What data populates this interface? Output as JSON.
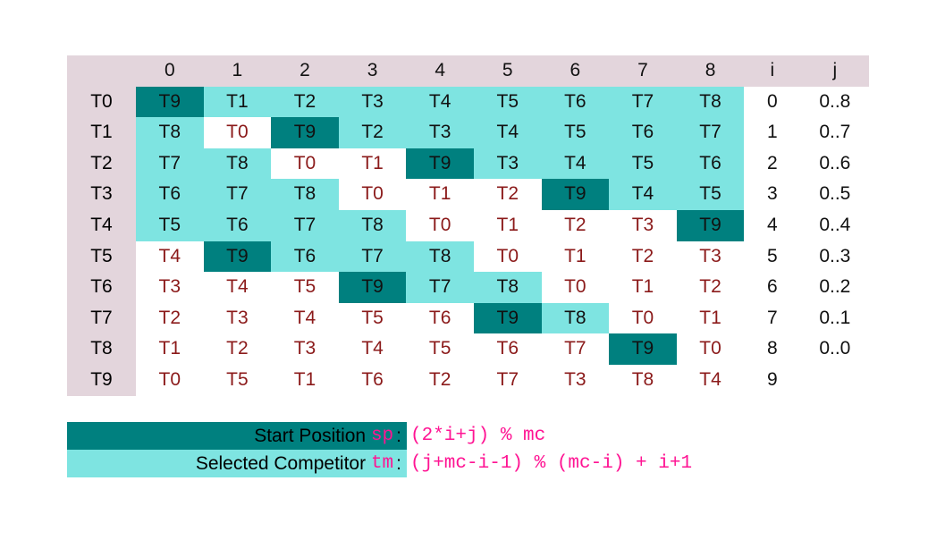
{
  "colors": {
    "start_position": "#00807f",
    "selected_competitor": "#7ee4e1",
    "header_band": "#e3d5dc",
    "cell_text": "#8b1a1a",
    "formula_text": "#ff1493",
    "page_background": "#ffffff"
  },
  "table": {
    "corner_label": "",
    "column_headers": [
      "0",
      "1",
      "2",
      "3",
      "4",
      "5",
      "6",
      "7",
      "8"
    ],
    "side_headers": [
      "i",
      "j"
    ],
    "row_labels": [
      "T0",
      "T1",
      "T2",
      "T3",
      "T4",
      "T5",
      "T6",
      "T7",
      "T8",
      "T9"
    ],
    "i_values": [
      "0",
      "1",
      "2",
      "3",
      "4",
      "5",
      "6",
      "7",
      "8",
      "9"
    ],
    "j_values": [
      "0..8",
      "0..7",
      "0..6",
      "0..5",
      "0..4",
      "0..3",
      "0..2",
      "0..1",
      "0..0",
      ""
    ],
    "rows": [
      {
        "label": "T0",
        "cells": [
          {
            "text": "T9",
            "state": "sp"
          },
          {
            "text": "T1",
            "state": "tm"
          },
          {
            "text": "T2",
            "state": "tm"
          },
          {
            "text": "T3",
            "state": "tm"
          },
          {
            "text": "T4",
            "state": "tm"
          },
          {
            "text": "T5",
            "state": "tm"
          },
          {
            "text": "T6",
            "state": "tm"
          },
          {
            "text": "T7",
            "state": "tm"
          },
          {
            "text": "T8",
            "state": "tm"
          }
        ],
        "i": "0",
        "j": "0..8"
      },
      {
        "label": "T1",
        "cells": [
          {
            "text": "T8",
            "state": "tm"
          },
          {
            "text": "T0",
            "state": "none"
          },
          {
            "text": "T9",
            "state": "sp"
          },
          {
            "text": "T2",
            "state": "tm"
          },
          {
            "text": "T3",
            "state": "tm"
          },
          {
            "text": "T4",
            "state": "tm"
          },
          {
            "text": "T5",
            "state": "tm"
          },
          {
            "text": "T6",
            "state": "tm"
          },
          {
            "text": "T7",
            "state": "tm"
          }
        ],
        "i": "1",
        "j": "0..7"
      },
      {
        "label": "T2",
        "cells": [
          {
            "text": "T7",
            "state": "tm"
          },
          {
            "text": "T8",
            "state": "tm"
          },
          {
            "text": "T0",
            "state": "none"
          },
          {
            "text": "T1",
            "state": "none"
          },
          {
            "text": "T9",
            "state": "sp"
          },
          {
            "text": "T3",
            "state": "tm"
          },
          {
            "text": "T4",
            "state": "tm"
          },
          {
            "text": "T5",
            "state": "tm"
          },
          {
            "text": "T6",
            "state": "tm"
          }
        ],
        "i": "2",
        "j": "0..6"
      },
      {
        "label": "T3",
        "cells": [
          {
            "text": "T6",
            "state": "tm"
          },
          {
            "text": "T7",
            "state": "tm"
          },
          {
            "text": "T8",
            "state": "tm"
          },
          {
            "text": "T0",
            "state": "none"
          },
          {
            "text": "T1",
            "state": "none"
          },
          {
            "text": "T2",
            "state": "none"
          },
          {
            "text": "T9",
            "state": "sp"
          },
          {
            "text": "T4",
            "state": "tm"
          },
          {
            "text": "T5",
            "state": "tm"
          }
        ],
        "i": "3",
        "j": "0..5"
      },
      {
        "label": "T4",
        "cells": [
          {
            "text": "T5",
            "state": "tm"
          },
          {
            "text": "T6",
            "state": "tm"
          },
          {
            "text": "T7",
            "state": "tm"
          },
          {
            "text": "T8",
            "state": "tm"
          },
          {
            "text": "T0",
            "state": "none"
          },
          {
            "text": "T1",
            "state": "none"
          },
          {
            "text": "T2",
            "state": "none"
          },
          {
            "text": "T3",
            "state": "none"
          },
          {
            "text": "T9",
            "state": "sp"
          }
        ],
        "i": "4",
        "j": "0..4"
      },
      {
        "label": "T5",
        "cells": [
          {
            "text": "T4",
            "state": "none"
          },
          {
            "text": "T9",
            "state": "sp"
          },
          {
            "text": "T6",
            "state": "tm"
          },
          {
            "text": "T7",
            "state": "tm"
          },
          {
            "text": "T8",
            "state": "tm"
          },
          {
            "text": "T0",
            "state": "none"
          },
          {
            "text": "T1",
            "state": "none"
          },
          {
            "text": "T2",
            "state": "none"
          },
          {
            "text": "T3",
            "state": "none"
          }
        ],
        "i": "5",
        "j": "0..3"
      },
      {
        "label": "T6",
        "cells": [
          {
            "text": "T3",
            "state": "none"
          },
          {
            "text": "T4",
            "state": "none"
          },
          {
            "text": "T5",
            "state": "none"
          },
          {
            "text": "T9",
            "state": "sp"
          },
          {
            "text": "T7",
            "state": "tm"
          },
          {
            "text": "T8",
            "state": "tm"
          },
          {
            "text": "T0",
            "state": "none"
          },
          {
            "text": "T1",
            "state": "none"
          },
          {
            "text": "T2",
            "state": "none"
          }
        ],
        "i": "6",
        "j": "0..2"
      },
      {
        "label": "T7",
        "cells": [
          {
            "text": "T2",
            "state": "none"
          },
          {
            "text": "T3",
            "state": "none"
          },
          {
            "text": "T4",
            "state": "none"
          },
          {
            "text": "T5",
            "state": "none"
          },
          {
            "text": "T6",
            "state": "none"
          },
          {
            "text": "T9",
            "state": "sp"
          },
          {
            "text": "T8",
            "state": "tm"
          },
          {
            "text": "T0",
            "state": "none"
          },
          {
            "text": "T1",
            "state": "none"
          }
        ],
        "i": "7",
        "j": "0..1"
      },
      {
        "label": "T8",
        "cells": [
          {
            "text": "T1",
            "state": "none"
          },
          {
            "text": "T2",
            "state": "none"
          },
          {
            "text": "T3",
            "state": "none"
          },
          {
            "text": "T4",
            "state": "none"
          },
          {
            "text": "T5",
            "state": "none"
          },
          {
            "text": "T6",
            "state": "none"
          },
          {
            "text": "T7",
            "state": "none"
          },
          {
            "text": "T9",
            "state": "sp"
          },
          {
            "text": "T0",
            "state": "none"
          }
        ],
        "i": "8",
        "j": "0..0"
      },
      {
        "label": "T9",
        "cells": [
          {
            "text": "T0",
            "state": "none"
          },
          {
            "text": "T5",
            "state": "none"
          },
          {
            "text": "T1",
            "state": "none"
          },
          {
            "text": "T6",
            "state": "none"
          },
          {
            "text": "T2",
            "state": "none"
          },
          {
            "text": "T7",
            "state": "none"
          },
          {
            "text": "T3",
            "state": "none"
          },
          {
            "text": "T8",
            "state": "none"
          },
          {
            "text": "T4",
            "state": "none"
          }
        ],
        "i": "9",
        "j": ""
      }
    ]
  },
  "legend": {
    "rows": [
      {
        "swatch": "sp",
        "label": "Start Position ",
        "variable": "sp",
        "colon": ":",
        "formula": "(2*i+j) % mc"
      },
      {
        "swatch": "tm",
        "label": "Selected Competitor ",
        "variable": "tm",
        "colon": ":",
        "formula": "(j+mc-i-1) % (mc-i) + i+1"
      }
    ]
  }
}
